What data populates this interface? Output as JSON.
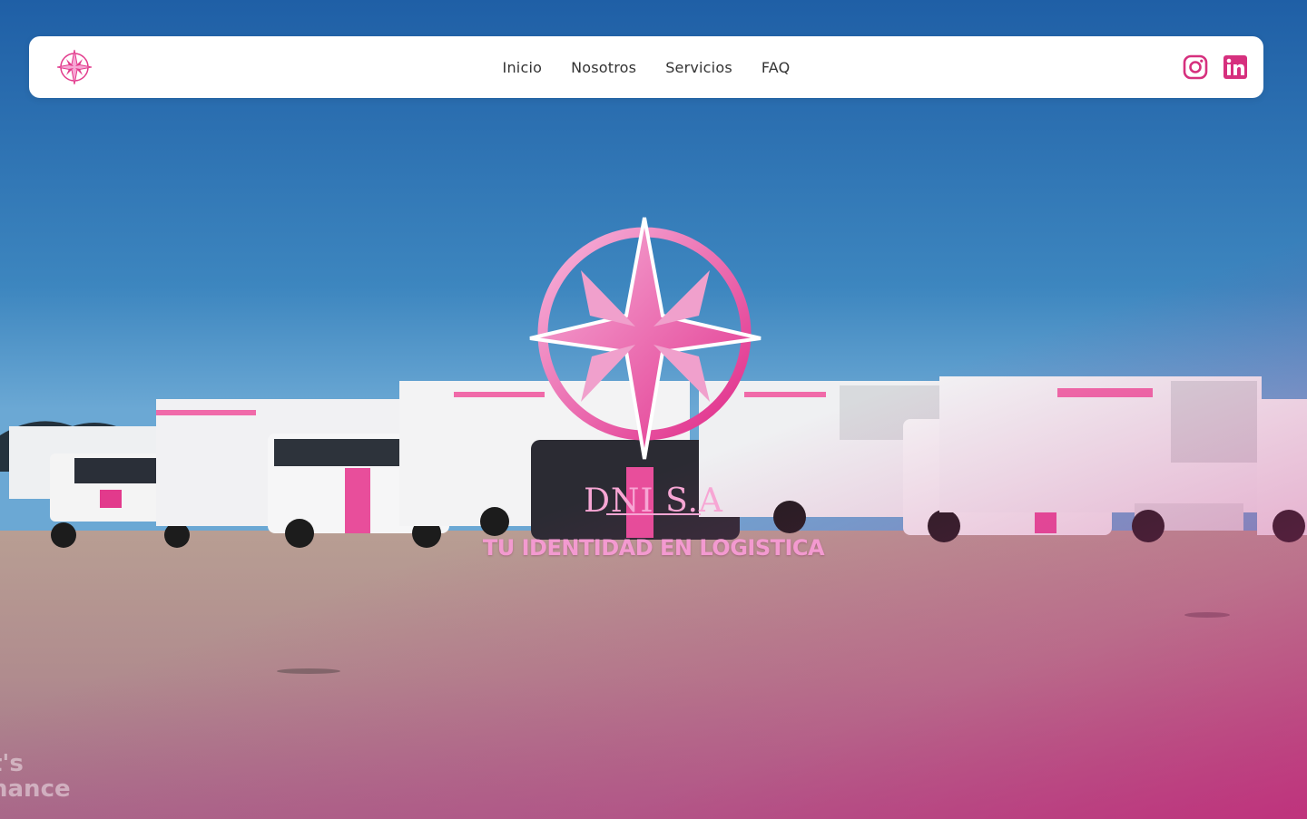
{
  "nav": {
    "links": [
      "Inicio",
      "Nosotros",
      "Servicios",
      "FAQ"
    ],
    "socials": {
      "instagram": "instagram-icon",
      "linkedin": "linkedin-icon"
    }
  },
  "hero": {
    "brand_name": "DNI S.A",
    "tagline": "TU IDENTIDAD EN LOGISTICA",
    "watermark_line1": "t's",
    "watermark_line2": "hance"
  },
  "colors": {
    "brand_pink": "#e23a8c",
    "brand_light_pink": "#f7a6d4",
    "sky_blue": "#2e6aa8",
    "nav_bg": "#ffffff"
  }
}
